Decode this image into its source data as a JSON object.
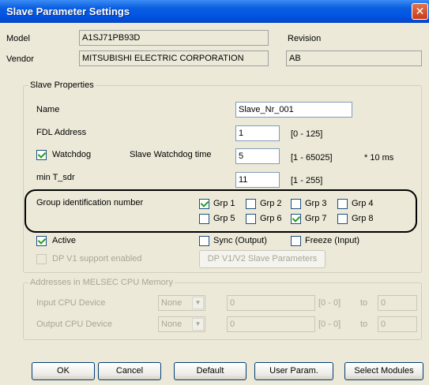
{
  "window": {
    "title": "Slave Parameter Settings",
    "close_symbol": "✕"
  },
  "header": {
    "model_label": "Model",
    "model_value": "A1SJ71PB93D",
    "revision_label": "Revision",
    "revision_value": "",
    "vendor_label": "Vendor",
    "vendor_value": "MITSUBISHI ELECTRIC CORPORATION",
    "vendor_extra_value": "AB"
  },
  "slave_properties": {
    "legend": "Slave Properties",
    "name_label": "Name",
    "name_value": "Slave_Nr_001",
    "fdl_label": "FDL Address",
    "fdl_value": "1",
    "fdl_range": "[0 - 125]",
    "watchdog_label": "Watchdog",
    "watchdog_checked": true,
    "watchdog_time_label": "Slave Watchdog time",
    "watchdog_time_value": "5",
    "watchdog_time_range": "[1 - 65025]",
    "watchdog_unit": "* 10 ms",
    "tsdr_label": "min T_sdr",
    "tsdr_value": "11",
    "tsdr_range": "[1 - 255]",
    "group_label": "Group identification number",
    "groups": [
      {
        "label": "Grp 1",
        "checked": true
      },
      {
        "label": "Grp 2",
        "checked": false
      },
      {
        "label": "Grp 3",
        "checked": false
      },
      {
        "label": "Grp 4",
        "checked": false
      },
      {
        "label": "Grp 5",
        "checked": false
      },
      {
        "label": "Grp 6",
        "checked": false
      },
      {
        "label": "Grp 7",
        "checked": true
      },
      {
        "label": "Grp 8",
        "checked": false
      }
    ],
    "active_label": "Active",
    "active_checked": true,
    "sync_label": "Sync (Output)",
    "freeze_label": "Freeze (Input)",
    "dpv1_label": "DP V1 support enabled",
    "dpv1_button_label": "DP V1/V2 Slave Parameters"
  },
  "addresses": {
    "legend": "Addresses in MELSEC CPU Memory",
    "input_label": "Input CPU Device",
    "output_label": "Output CPU Device",
    "device_value": "None",
    "start_value": "0",
    "range": "[0 - 0]",
    "to_label": "to",
    "end_value": "0"
  },
  "buttons": {
    "ok": "OK",
    "cancel": "Cancel",
    "default": "Default",
    "user_param": "User Param.",
    "select_modules": "Select Modules"
  }
}
